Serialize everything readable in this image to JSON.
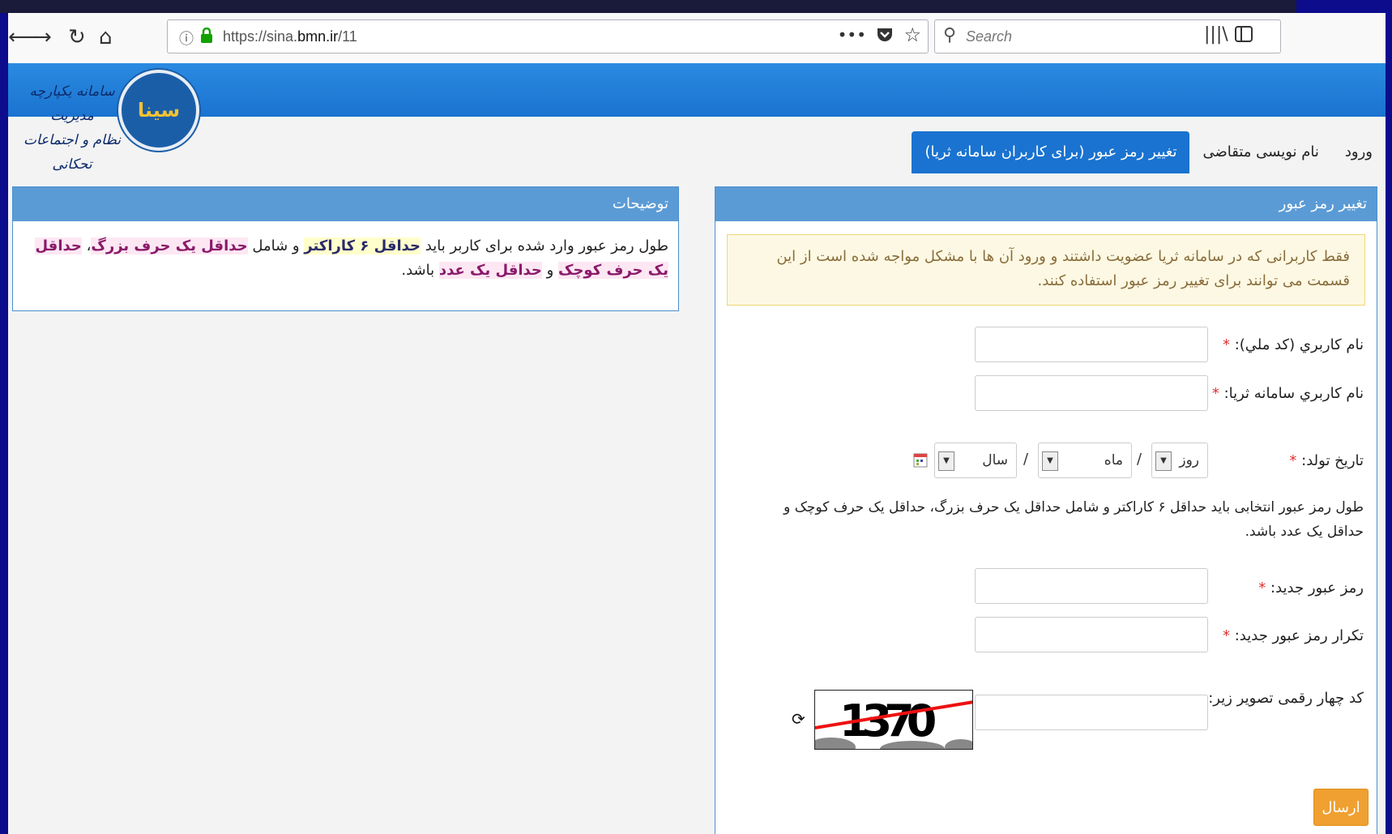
{
  "browser": {
    "url_prefix": "https://sina.",
    "url_domain": "bmn.ir",
    "url_path": "/11",
    "search_placeholder": "Search"
  },
  "site": {
    "logo_mark": "سینا",
    "logo_text_line1": "سامانه یکپارچه مدیریت",
    "logo_text_line2": "نظام و اجتماعات تحکانی"
  },
  "nav": {
    "tabs": [
      "ورود",
      "نام نویسی متقاضی",
      "تغییر رمز عبور (برای کاربران سامانه ثریا)"
    ]
  },
  "form_panel": {
    "title": "تغییر رمز عبور",
    "alert": "فقط کاربرانی که در سامانه ثریا عضویت داشتند و ورود آن ها با مشکل مواجه شده است از این قسمت می توانند برای تغییر رمز عبور استفاده کنند.",
    "username_label": "نام کاربري (کد ملي):",
    "soraya_username_label": "نام کاربري سامانه ثریا:",
    "birthdate_label": "تاریخ تولد:",
    "day_placeholder": "روز",
    "month_placeholder": "ماه",
    "year_placeholder": "سال",
    "password_hint": "طول رمز عبور انتخابی باید حداقل ۶ کاراکتر و شامل حداقل یک حرف بزرگ، حداقل یک حرف کوچک و حداقل یک عدد باشد.",
    "new_password_label": "رمز عبور جدید:",
    "repeat_password_label": "تکرار رمز عبور جدید:",
    "captcha_label": "کد چهار رقمی تصویر زیر:",
    "captcha_text": "1370",
    "submit_label": "ارسال",
    "required_mark": "*"
  },
  "desc_panel": {
    "title": "توضیحات",
    "part1": "طول رمز عبور وارد شده برای کاربر باید ",
    "hl_min_chars": "حداقل ۶ کاراکتر",
    "part2": " و شامل ",
    "hl_upper": "حداقل یک حرف بزرگ",
    "sep1": "، ",
    "hl_lower": "حداقل یک حرف کوچک",
    "part3": " و ",
    "hl_digit": "حداقل یک عدد",
    "part4": " باشد."
  }
}
